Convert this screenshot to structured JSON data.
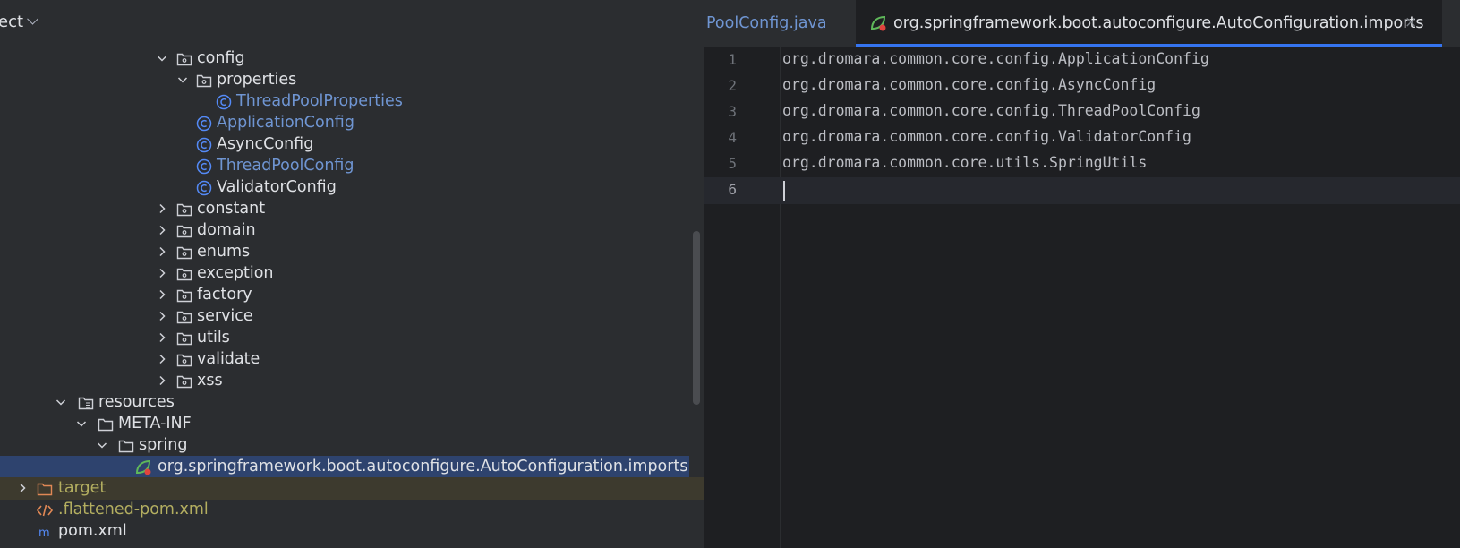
{
  "project_panel": {
    "title": "ect",
    "tree": [
      {
        "label": "config",
        "kind": "package",
        "expanded": true,
        "color": "default"
      },
      {
        "label": "properties",
        "kind": "package",
        "expanded": true,
        "color": "default"
      },
      {
        "label": "ThreadPoolProperties",
        "kind": "class",
        "color": "blue"
      },
      {
        "label": "ApplicationConfig",
        "kind": "class",
        "color": "blue"
      },
      {
        "label": "AsyncConfig",
        "kind": "class",
        "color": "default"
      },
      {
        "label": "ThreadPoolConfig",
        "kind": "class",
        "color": "blue"
      },
      {
        "label": "ValidatorConfig",
        "kind": "class",
        "color": "default"
      },
      {
        "label": "constant",
        "kind": "package",
        "expanded": false,
        "color": "default"
      },
      {
        "label": "domain",
        "kind": "package",
        "expanded": false,
        "color": "default"
      },
      {
        "label": "enums",
        "kind": "package",
        "expanded": false,
        "color": "default"
      },
      {
        "label": "exception",
        "kind": "package",
        "expanded": false,
        "color": "default"
      },
      {
        "label": "factory",
        "kind": "package",
        "expanded": false,
        "color": "default"
      },
      {
        "label": "service",
        "kind": "package",
        "expanded": false,
        "color": "default"
      },
      {
        "label": "utils",
        "kind": "package",
        "expanded": false,
        "color": "default"
      },
      {
        "label": "validate",
        "kind": "package",
        "expanded": false,
        "color": "default"
      },
      {
        "label": "xss",
        "kind": "package",
        "expanded": false,
        "color": "default"
      },
      {
        "label": "resources",
        "kind": "resources-folder",
        "expanded": true,
        "color": "default"
      },
      {
        "label": "META-INF",
        "kind": "folder",
        "expanded": true,
        "color": "default"
      },
      {
        "label": "spring",
        "kind": "folder",
        "expanded": true,
        "color": "default"
      },
      {
        "label": "org.springframework.boot.autoconfigure.AutoConfiguration.imports",
        "kind": "spring-file",
        "color": "default",
        "selected": true
      },
      {
        "label": "target",
        "kind": "excluded-folder",
        "expanded": false,
        "color": "olive"
      },
      {
        "label": ".flattened-pom.xml",
        "kind": "xml-file",
        "color": "olive"
      },
      {
        "label": "pom.xml",
        "kind": "maven-file",
        "color": "default"
      }
    ]
  },
  "editor": {
    "tabs": [
      {
        "label": "PoolConfig.java",
        "active": false
      },
      {
        "label": "org.springframework.boot.autoconfigure.AutoConfiguration.imports",
        "active": true,
        "close": "×"
      }
    ],
    "lines": [
      {
        "num": "1",
        "text": "org.dromara.common.core.config.ApplicationConfig"
      },
      {
        "num": "2",
        "text": "org.dromara.common.core.config.AsyncConfig"
      },
      {
        "num": "3",
        "text": "org.dromara.common.core.config.ThreadPoolConfig"
      },
      {
        "num": "4",
        "text": "org.dromara.common.core.config.ValidatorConfig"
      },
      {
        "num": "5",
        "text": "org.dromara.common.core.utils.SpringUtils"
      },
      {
        "num": "6",
        "text": ""
      }
    ],
    "current_line": "6"
  },
  "colors": {
    "panel_bg": "#2b2d30",
    "editor_bg": "#1e1f22",
    "selection": "#2e436e",
    "excluded_bg": "#3d3a2e",
    "class_icon": "#548af7",
    "accent": "#3574f0"
  }
}
